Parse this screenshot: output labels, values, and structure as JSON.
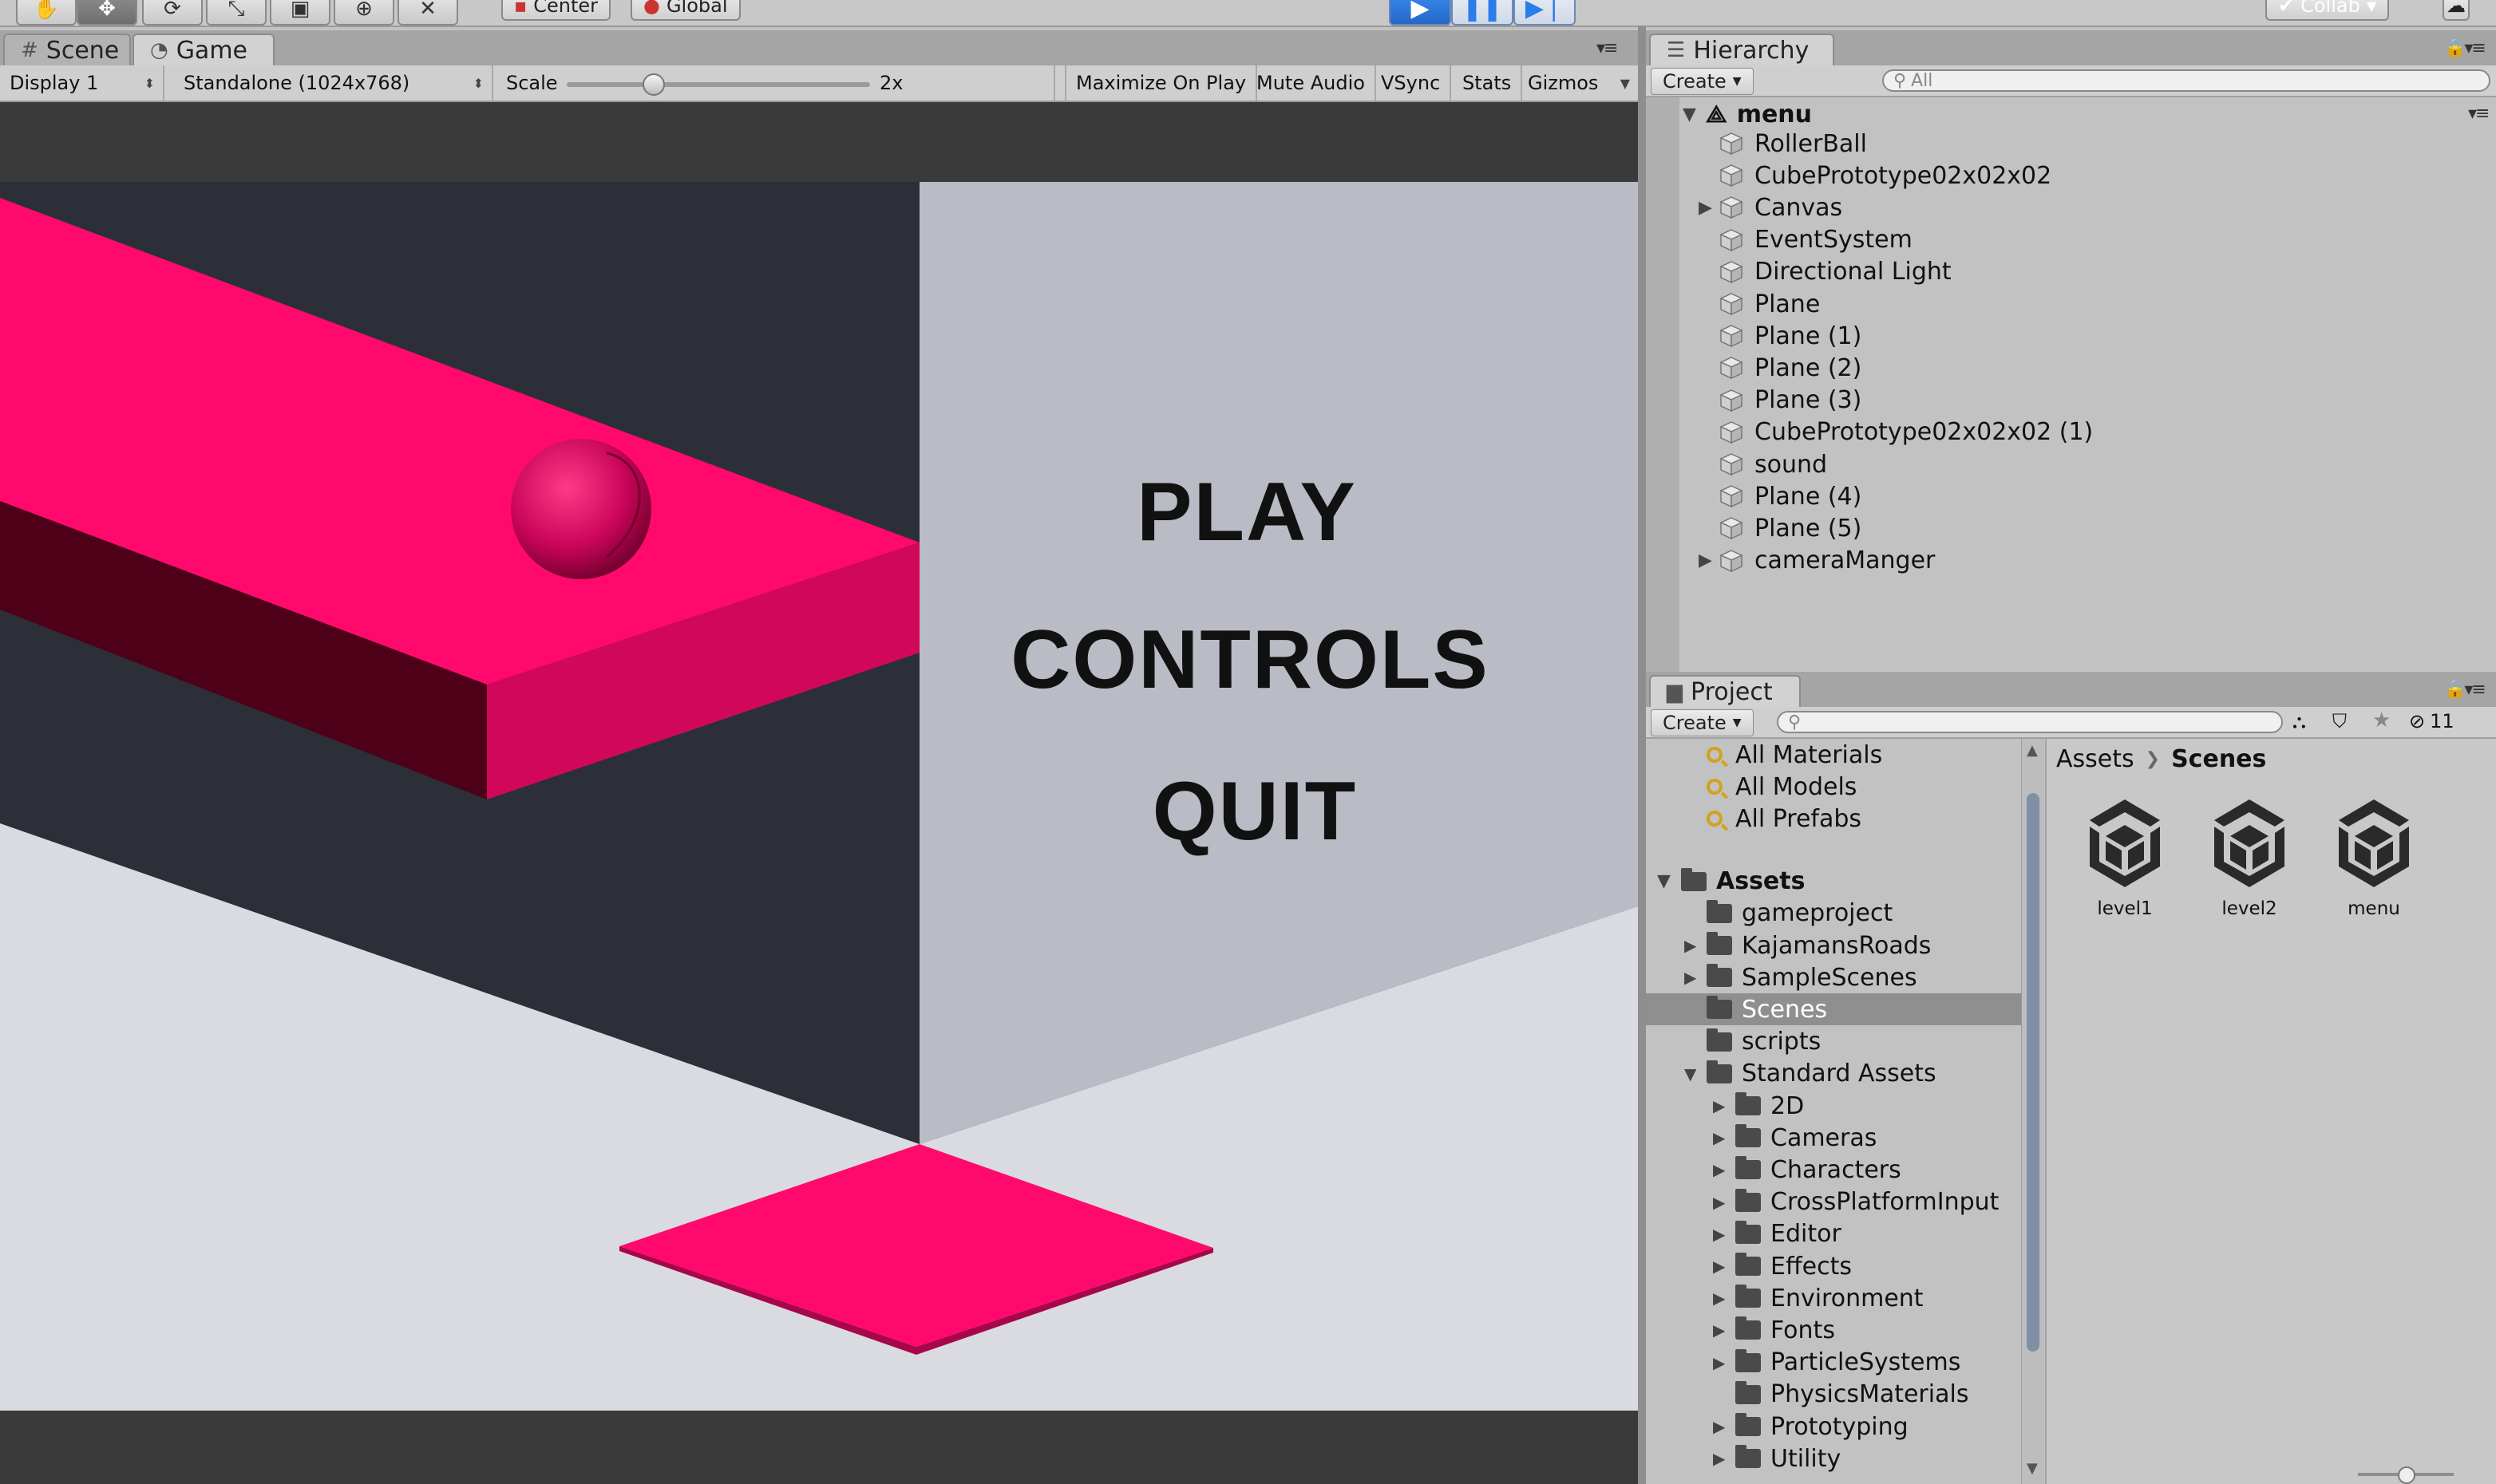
{
  "toolbar": {
    "pivot_label": "Center",
    "space_label": "Global",
    "collab_label": "Collab"
  },
  "scene_tabs": {
    "scene": "Scene",
    "game": "Game"
  },
  "game_toolbar": {
    "display": "Display 1",
    "resolution": "Standalone (1024x768)",
    "scale_label": "Scale",
    "scale_value": "2x",
    "maximize": "Maximize On Play",
    "mute": "Mute Audio",
    "vsync": "VSync",
    "stats": "Stats",
    "gizmos": "Gizmos"
  },
  "game_view": {
    "menu": {
      "play": "PLAY",
      "controls": "CONTROLS",
      "quit": "QUIT"
    },
    "colors": {
      "platform": "#ff0a6c",
      "platform_side": "#d1085a",
      "platform_bottom": "#4a0016",
      "background_dark": "#2c2f38",
      "wall": "#b9bcc5",
      "floor": "#d9dbe1"
    }
  },
  "hierarchy": {
    "title": "Hierarchy",
    "create": "Create",
    "search_placeholder": "All",
    "scene_name": "menu",
    "items": [
      {
        "name": "RollerBall",
        "expandable": false
      },
      {
        "name": "CubePrototype02x02x02",
        "expandable": false
      },
      {
        "name": "Canvas",
        "expandable": true
      },
      {
        "name": "EventSystem",
        "expandable": false
      },
      {
        "name": "Directional Light",
        "expandable": false
      },
      {
        "name": "Plane",
        "expandable": false
      },
      {
        "name": "Plane (1)",
        "expandable": false
      },
      {
        "name": "Plane (2)",
        "expandable": false
      },
      {
        "name": "Plane (3)",
        "expandable": false
      },
      {
        "name": "CubePrototype02x02x02 (1)",
        "expandable": false
      },
      {
        "name": "sound",
        "expandable": false
      },
      {
        "name": "Plane (4)",
        "expandable": false
      },
      {
        "name": "Plane (5)",
        "expandable": false
      },
      {
        "name": "cameraManger",
        "expandable": true
      }
    ]
  },
  "project": {
    "title": "Project",
    "create": "Create",
    "hidden_count": "11",
    "favorites": [
      "All Materials",
      "All Models",
      "All Prefabs"
    ],
    "root": "Assets",
    "tree": [
      {
        "name": "gameproject",
        "depth": 1,
        "expandable": false,
        "selected": false
      },
      {
        "name": "KajamansRoads",
        "depth": 1,
        "expandable": true,
        "selected": false
      },
      {
        "name": "SampleScenes",
        "depth": 1,
        "expandable": true,
        "selected": false
      },
      {
        "name": "Scenes",
        "depth": 1,
        "expandable": false,
        "selected": true
      },
      {
        "name": "scripts",
        "depth": 1,
        "expandable": false,
        "selected": false
      },
      {
        "name": "Standard Assets",
        "depth": 1,
        "expandable": true,
        "expanded": true,
        "selected": false
      },
      {
        "name": "2D",
        "depth": 2,
        "expandable": true,
        "selected": false
      },
      {
        "name": "Cameras",
        "depth": 2,
        "expandable": true,
        "selected": false
      },
      {
        "name": "Characters",
        "depth": 2,
        "expandable": true,
        "selected": false
      },
      {
        "name": "CrossPlatformInput",
        "depth": 2,
        "expandable": true,
        "selected": false
      },
      {
        "name": "Editor",
        "depth": 2,
        "expandable": true,
        "selected": false
      },
      {
        "name": "Effects",
        "depth": 2,
        "expandable": true,
        "selected": false
      },
      {
        "name": "Environment",
        "depth": 2,
        "expandable": true,
        "selected": false
      },
      {
        "name": "Fonts",
        "depth": 2,
        "expandable": true,
        "selected": false
      },
      {
        "name": "ParticleSystems",
        "depth": 2,
        "expandable": true,
        "selected": false
      },
      {
        "name": "PhysicsMaterials",
        "depth": 2,
        "expandable": false,
        "selected": false
      },
      {
        "name": "Prototyping",
        "depth": 2,
        "expandable": true,
        "selected": false
      },
      {
        "name": "Utility",
        "depth": 2,
        "expandable": true,
        "selected": false
      }
    ],
    "breadcrumb": [
      "Assets",
      "Scenes"
    ],
    "assets": [
      "level1",
      "level2",
      "menu"
    ]
  }
}
